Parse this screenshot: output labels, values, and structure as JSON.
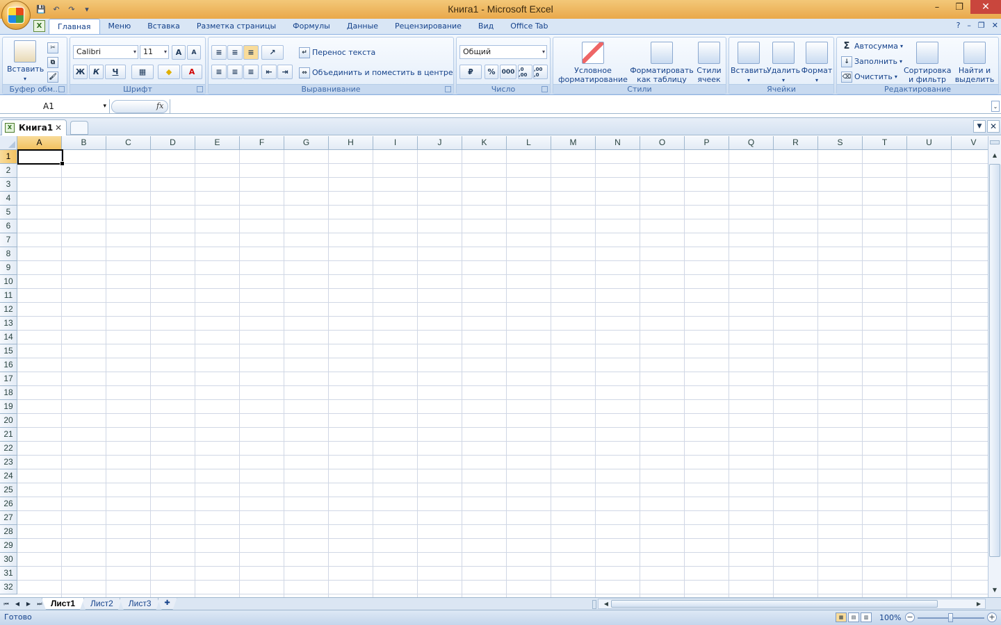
{
  "window": {
    "title": "Книга1 - Microsoft Excel",
    "minimize": "–",
    "restore": "❐",
    "close": "✕"
  },
  "qat": {
    "save": "💾",
    "undo": "↶",
    "redo": "↷",
    "customize": "▾"
  },
  "tabs": [
    "Главная",
    "Меню",
    "Вставка",
    "Разметка страницы",
    "Формулы",
    "Данные",
    "Рецензирование",
    "Вид",
    "Office Tab"
  ],
  "active_tab": "Главная",
  "ribbon": {
    "clipboard": {
      "title": "Буфер обм...",
      "paste": "Вставить"
    },
    "font": {
      "title": "Шрифт",
      "name": "Calibri",
      "size": "11",
      "bold": "Ж",
      "italic": "К",
      "underline": "Ч",
      "grow": "A",
      "shrink": "A"
    },
    "alignment": {
      "title": "Выравнивание",
      "wrap": "Перенос текста",
      "merge": "Объединить и поместить в центре"
    },
    "number": {
      "title": "Число",
      "format": "Общий",
      "percent": "%",
      "thousands": "000",
      "inc_dec": ",0 ,00",
      "dec_dec": ",00 ,0"
    },
    "styles": {
      "title": "Стили",
      "conditional": "Условное форматирование",
      "as_table": "Форматировать как таблицу",
      "cell_styles": "Стили ячеек"
    },
    "cells": {
      "title": "Ячейки",
      "insert": "Вставить",
      "delete": "Удалить",
      "format": "Формат"
    },
    "editing": {
      "title": "Редактирование",
      "autosum": "Автосумма",
      "fill": "Заполнить",
      "clear": "Очистить",
      "sort": "Сортировка и фильтр",
      "find": "Найти и выделить"
    }
  },
  "formula_bar": {
    "name_box": "A1",
    "fx": "fx",
    "value": ""
  },
  "doc_tab": {
    "name": "Книга1",
    "close": "✕"
  },
  "columns": [
    "A",
    "B",
    "C",
    "D",
    "E",
    "F",
    "G",
    "H",
    "I",
    "J",
    "K",
    "L",
    "M",
    "N",
    "O",
    "P",
    "Q",
    "R",
    "S",
    "T",
    "U",
    "V"
  ],
  "rows": [
    "1",
    "2",
    "3",
    "4",
    "5",
    "6",
    "7",
    "8",
    "9",
    "10",
    "11",
    "12",
    "13",
    "14",
    "15",
    "16",
    "17",
    "18",
    "19",
    "20",
    "21",
    "22",
    "23",
    "24",
    "25",
    "26",
    "27",
    "28",
    "29",
    "30",
    "31",
    "32"
  ],
  "selected_cell": {
    "col": "A",
    "row": "1"
  },
  "sheets": [
    "Лист1",
    "Лист2",
    "Лист3"
  ],
  "active_sheet": "Лист1",
  "status": {
    "text": "Готово",
    "zoom": "100%"
  }
}
